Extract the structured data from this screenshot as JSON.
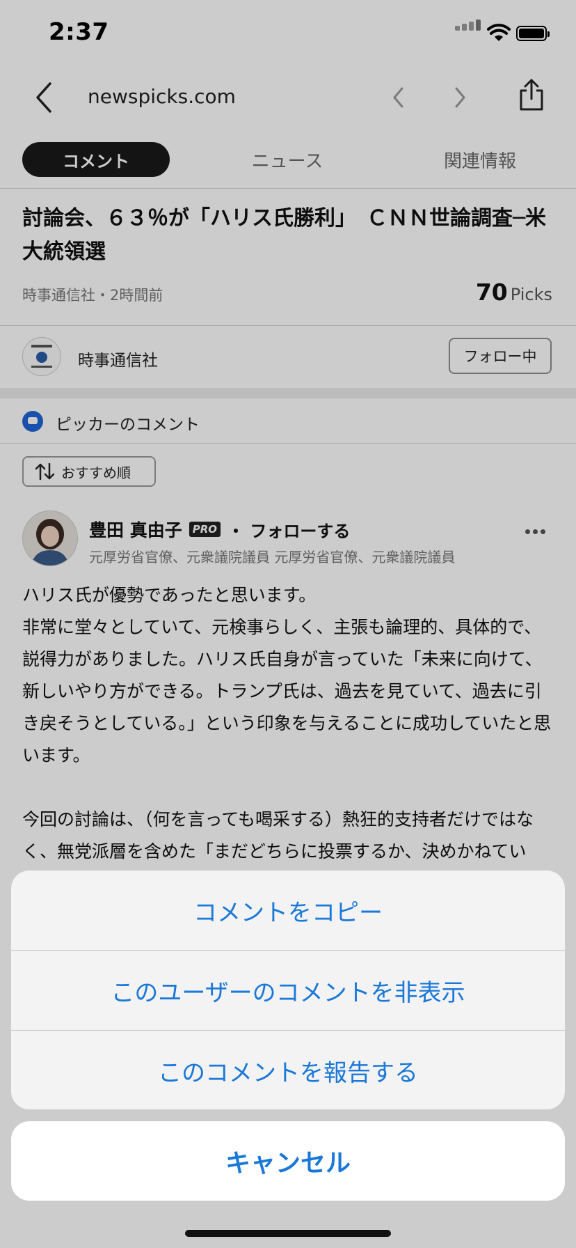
{
  "status_bar": {
    "time": "2:37"
  },
  "browser": {
    "url": "newspicks.com"
  },
  "tabs": [
    {
      "label": "コメント",
      "active": true
    },
    {
      "label": "ニュース"
    },
    {
      "label": "関連情報"
    }
  ],
  "article": {
    "title": "討論会、６３％が「ハリス氏勝利」　ＣＮＮ世論調査─米大統領選",
    "meta": "時事通信社・2時間前",
    "picks_count": "70",
    "picks_label": "Picks"
  },
  "publisher": {
    "name": "時事通信社",
    "follow_label": "フォロー中"
  },
  "comments_section": {
    "title": "ピッカーのコメント",
    "sort_label": "おすすめ順"
  },
  "comment": {
    "user_name": "豊田 真由子",
    "badge": "PRO",
    "follow_label": "・ フォローする",
    "role": "元厚労省官僚、元衆議院議員 元厚労省官僚、元衆議院議員",
    "paragraphs": [
      "ハリス氏が優勢であったと思います。",
      "非常に堂々としていて、元検事らしく、主張も論理的、具体的で、説得力がありました。ハリス氏自身が言っていた「未来に向けて、新しいやり方ができる。トランプ氏は、過去を見ていて、過去に引き戻そうとしている。」という印象を与えることに成功していたと思います。",
      "",
      "今回の討論は、（何を言っても喝采する）熱狂的支持者だけではなく、無党派層を含めた「まだどちらに投票するか、決めかねてい"
    ]
  },
  "action_sheet": {
    "options": [
      "コメントをコピー",
      "このユーザーのコメントを非表示",
      "このコメントを報告する"
    ],
    "cancel": "キャンセル"
  },
  "colors": {
    "accent": "#1978d8",
    "pill": "#1a1a1a",
    "section_icon": "#1e64d8"
  }
}
